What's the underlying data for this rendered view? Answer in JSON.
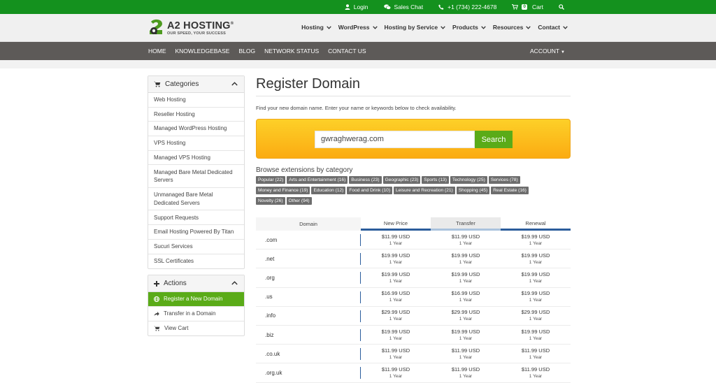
{
  "topbar": {
    "login": "Login",
    "sales_chat": "Sales Chat",
    "phone": "+1 (734) 222-4678",
    "cart_count": "0",
    "cart": "Cart"
  },
  "brand": {
    "name": "A2 HOSTING",
    "reg": "®",
    "tagline": "OUR SPEED, YOUR SUCCESS",
    "color_green": "#14911e"
  },
  "mainnav": [
    "Hosting",
    "WordPress",
    "Hosting by Service",
    "Products",
    "Resources",
    "Contact"
  ],
  "subnav": {
    "links": [
      "HOME",
      "KNOWLEDGEBASE",
      "BLOG",
      "NETWORK STATUS",
      "CONTACT US"
    ],
    "account": "ACCOUNT"
  },
  "sidebar": {
    "categories_title": "Categories",
    "categories": [
      "Web Hosting",
      "Reseller Hosting",
      "Managed WordPress Hosting",
      "VPS Hosting",
      "Managed VPS Hosting",
      "Managed Bare Metal Dedicated Servers",
      "Unmanaged Bare Metal Dedicated Servers",
      "Support Requests",
      "Email Hosting Powered By Titan",
      "Sucuri Services",
      "SSL Certificates"
    ],
    "actions_title": "Actions",
    "actions": [
      "Register a New Domain",
      "Transfer in a Domain",
      "View Cart"
    ]
  },
  "main": {
    "title": "Register Domain",
    "intro": "Find your new domain name. Enter your name or keywords below to check availability.",
    "search_value": "gwraghwerag.com",
    "search_button": "Search",
    "browse_title": "Browse extensions by category",
    "tags": [
      "Popular (22)",
      "Arts and Entertainment (16)",
      "Business (23)",
      "Geographic (23)",
      "Sports (13)",
      "Technology (25)",
      "Services (78)",
      "Money and Finance (19)",
      "Education (12)",
      "Food and Drink (10)",
      "Leisure and Recreation (21)",
      "Shopping (45)",
      "Real Estate (16)",
      "Novelty (26)",
      "Other (94)"
    ]
  },
  "pricing": {
    "headers": [
      "Domain",
      "New Price",
      "Transfer",
      "Renewal"
    ],
    "term": "1 Year",
    "rows": [
      {
        "tld": ".com",
        "new": "$11.99 USD",
        "transfer": "$11.99 USD",
        "renewal": "$19.99 USD"
      },
      {
        "tld": ".net",
        "new": "$19.99 USD",
        "transfer": "$19.99 USD",
        "renewal": "$19.99 USD"
      },
      {
        "tld": ".org",
        "new": "$19.99 USD",
        "transfer": "$19.99 USD",
        "renewal": "$19.99 USD"
      },
      {
        "tld": ".us",
        "new": "$16.99 USD",
        "transfer": "$16.99 USD",
        "renewal": "$19.99 USD"
      },
      {
        "tld": ".info",
        "new": "$29.99 USD",
        "transfer": "$29.99 USD",
        "renewal": "$29.99 USD"
      },
      {
        "tld": ".biz",
        "new": "$19.99 USD",
        "transfer": "$19.99 USD",
        "renewal": "$19.99 USD"
      },
      {
        "tld": ".co.uk",
        "new": "$11.99 USD",
        "transfer": "$11.99 USD",
        "renewal": "$11.99 USD"
      },
      {
        "tld": ".org.uk",
        "new": "$11.99 USD",
        "transfer": "$11.99 USD",
        "renewal": "$11.99 USD"
      }
    ]
  }
}
